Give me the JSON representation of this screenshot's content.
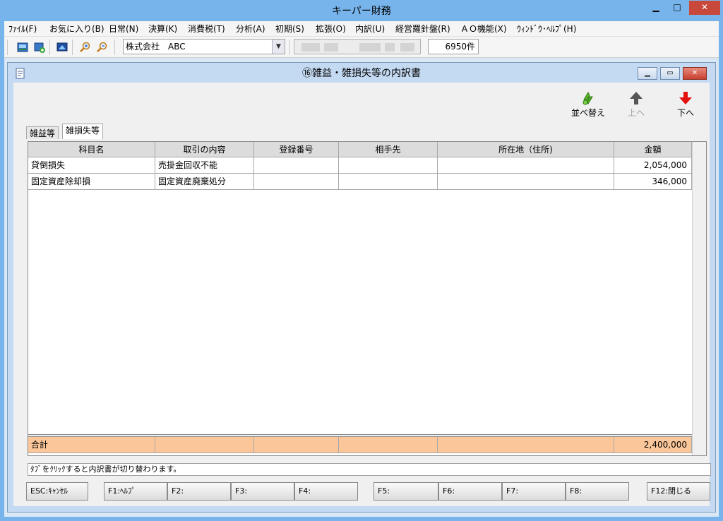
{
  "app": {
    "title": "キーパー財務",
    "controls": {
      "minimize": "▁",
      "maximize": "□",
      "close": "✕"
    }
  },
  "menu": [
    "ﾌｧｲﾙ(F)",
    "お気に入り(B)",
    "日常(N)",
    "決算(K)",
    "消費税(T)",
    "分析(A)",
    "初期(S)",
    "拡張(O)",
    "内訳(U)",
    "経営羅針盤(R)",
    "ＡＯ機能(X)",
    "ｳｨﾝﾄﾞｳ･ﾍﾙﾌﾟ(H)"
  ],
  "toolbar": {
    "company": "株式会社　ABC",
    "count": "6950件",
    "icons": [
      "save-image-icon",
      "import-icon",
      "monitor-icon",
      "zoom-in-icon",
      "zoom-out-icon"
    ]
  },
  "window": {
    "title": "⑯雑益・雑損失等の内訳書",
    "controls": {
      "minimize": "▁",
      "maximize": "▭",
      "close": "✕"
    }
  },
  "actions": {
    "sort": "並べ替え",
    "up": "上へ",
    "down": "下へ"
  },
  "tabs": [
    "雑益等",
    "雑損失等"
  ],
  "table": {
    "headers": [
      "科目名",
      "取引の内容",
      "登録番号",
      "相手先",
      "所在地（住所)",
      "金額"
    ],
    "rows": [
      [
        "貸倒損失",
        "売掛金回収不能",
        "",
        "",
        "",
        "2,054,000"
      ],
      [
        "固定資産除却損",
        "固定資産廃棄処分",
        "",
        "",
        "",
        "346,000"
      ]
    ],
    "total": {
      "label": "合計",
      "amount": "2,400,000"
    }
  },
  "status": "ﾀﾌﾞをｸﾘｯｸすると内訳書が切り替わります。",
  "function_keys": [
    "ESC:ｷｬﾝｾﾙ",
    "F1:ﾍﾙﾌﾟ",
    "F2:",
    "F3:",
    "F4:",
    "F5:",
    "F6:",
    "F7:",
    "F8:",
    "F12:閉じる"
  ]
}
